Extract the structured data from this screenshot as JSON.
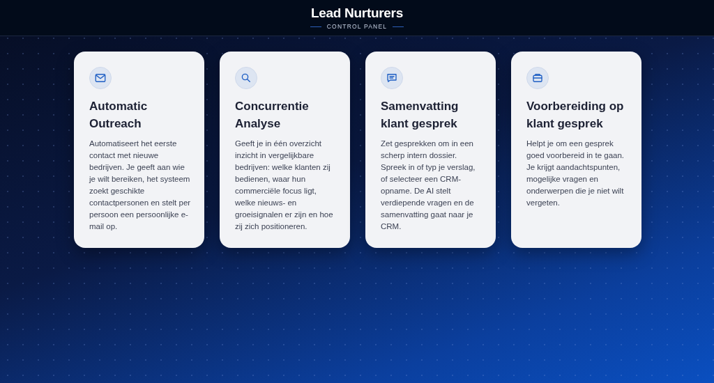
{
  "header": {
    "title": "Lead Nurturers",
    "subtitle": "CONTROL PANEL"
  },
  "cards": [
    {
      "kind": "mail",
      "title": "Automatic Outreach",
      "description": "Automatiseert het eerste contact met nieuwe bedrijven. Je geeft aan wie je wilt bereiken, het systeem zoekt geschikte contactpersonen en stelt per persoon een persoonlijke e-mail op."
    },
    {
      "kind": "search",
      "title": "Concurrentie Analyse",
      "description": "Geeft je in één overzicht inzicht in vergelijkbare bedrijven: welke klanten zij bedienen, waar hun commerciële focus ligt, welke nieuws- en groeisignalen er zijn en hoe zij zich positioneren."
    },
    {
      "kind": "chat",
      "title": "Samenvatting klant gesprek",
      "description": "Zet gesprekken om in een scherp intern dossier. Spreek in of typ je verslag, of selecteer een CRM-opname. De AI stelt verdiepende vragen en de samenvatting gaat naar je CRM."
    },
    {
      "kind": "briefcase",
      "title": "Voorbereiding op klant gesprek",
      "description": "Helpt je om een gesprek goed voorbereid in te gaan. Je krijgt aandachtspunten, mogelijke vragen en onderwerpen die je niet wilt vergeten."
    }
  ]
}
